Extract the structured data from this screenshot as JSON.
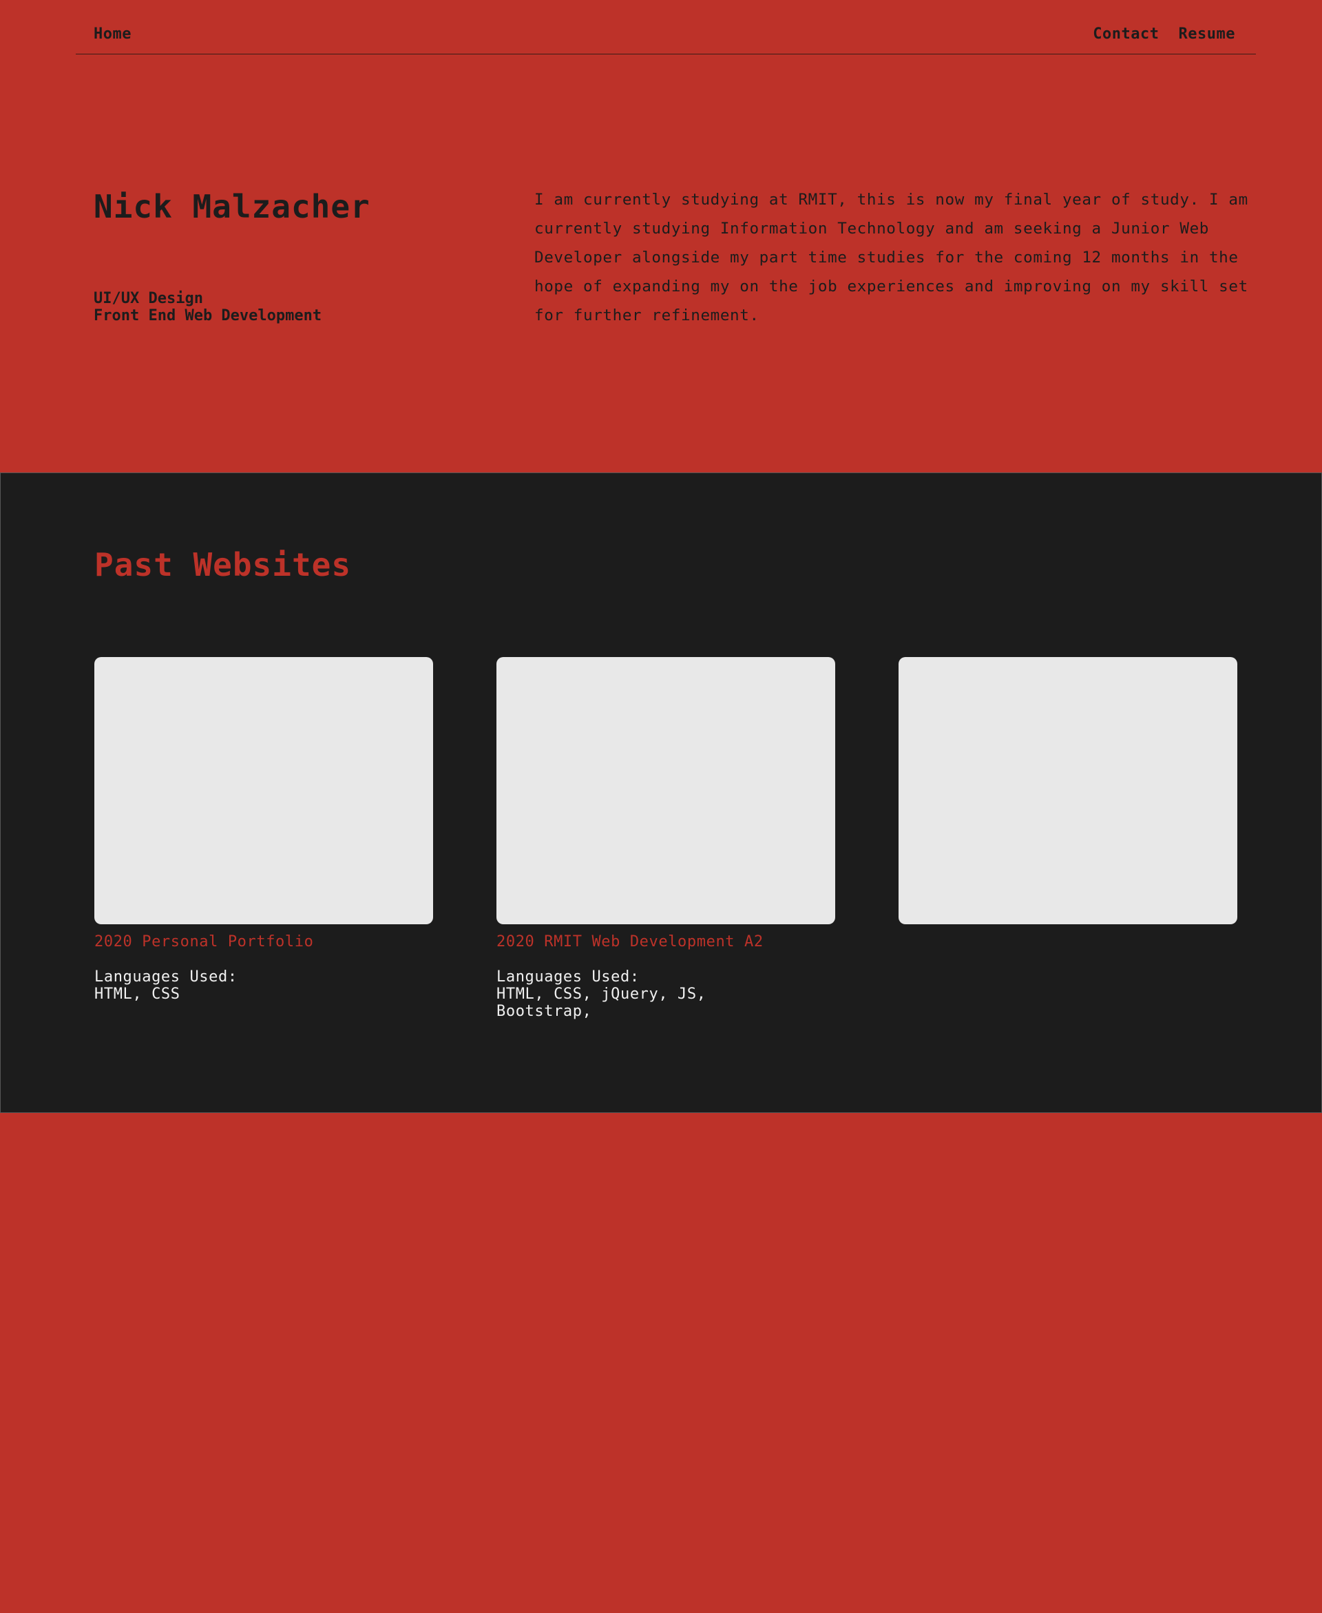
{
  "nav": {
    "home": "Home",
    "contact": "Contact",
    "resume": "Resume"
  },
  "hero": {
    "name": "Nick Malzacher",
    "roles": [
      "UI/UX Design",
      "Front End Web Development"
    ],
    "bio": "I am currently studying at RMIT, this is now my final year of study. I am currently studying Information Technology and am seeking a Junior Web Developer alongside my part time studies for the coming 12 months in the hope of expanding my on the job experiences and improving on my skill set for further refinement."
  },
  "projects": {
    "title": "Past Websites",
    "items": [
      {
        "title": "2020 Personal Portfolio",
        "languages_label": "Languages Used:",
        "languages": "HTML, CSS"
      },
      {
        "title": "2020 RMIT Web Development A2",
        "languages_label": "Languages Used:",
        "languages": "HTML, CSS, jQuery, JS, Bootstrap,"
      },
      {
        "title": "",
        "languages_label": "",
        "languages": ""
      }
    ]
  },
  "colors": {
    "background": "#bd3229",
    "dark": "#1c1c1c",
    "thumbnail": "#e8e8e8",
    "light_text": "#f0f0f0"
  }
}
